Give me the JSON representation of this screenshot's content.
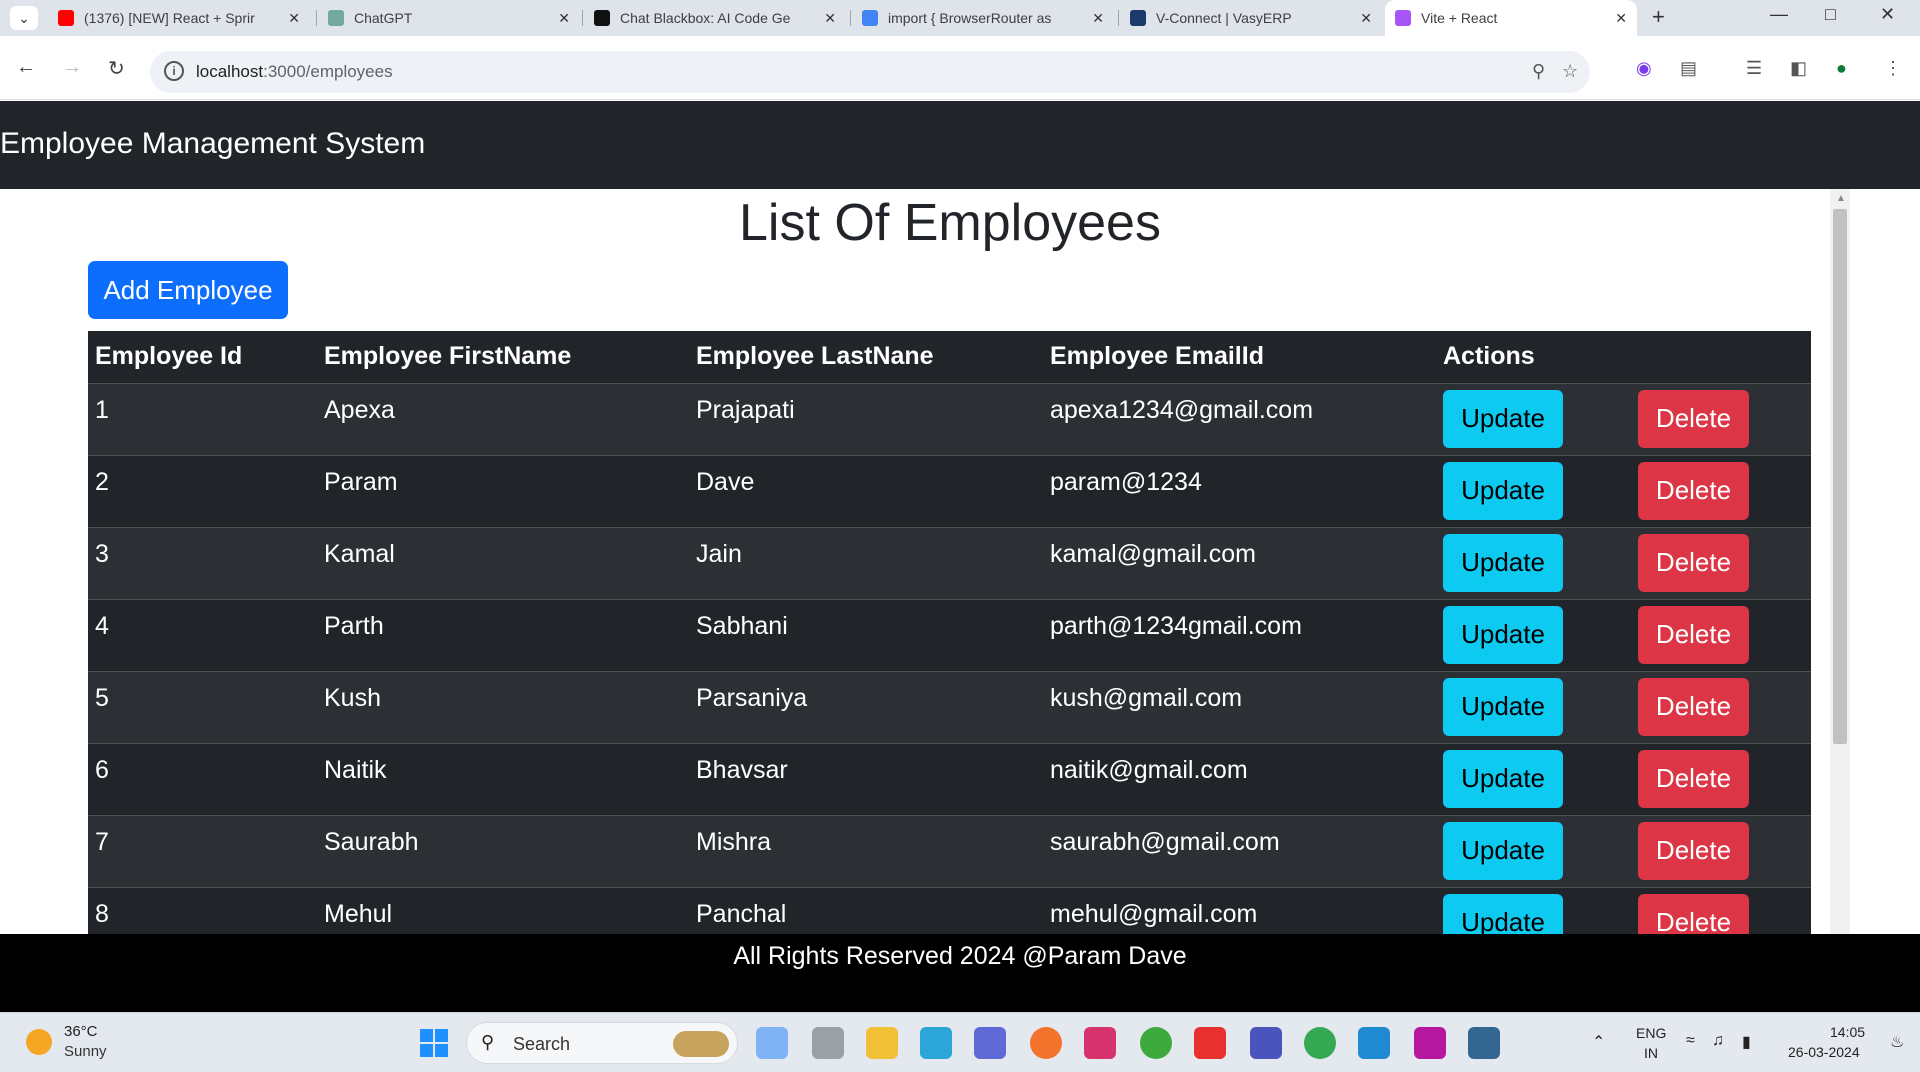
{
  "browser": {
    "tabs": [
      {
        "title": "(1376) [NEW] React + Sprir",
        "color": "#ff0000"
      },
      {
        "title": "ChatGPT",
        "color": "#74aa9c"
      },
      {
        "title": "Chat Blackbox: AI Code Ge",
        "color": "#111111"
      },
      {
        "title": "import { BrowserRouter as",
        "color": "#4285f4"
      },
      {
        "title": "V-Connect | VasyERP",
        "color": "#1b3a6b"
      },
      {
        "title": "Vite + React",
        "color": "#a855f7"
      }
    ],
    "url_host": "localhost",
    "url_path": ":3000/employees"
  },
  "app": {
    "brand": "Employee Management System",
    "page_title": "List Of Employees",
    "add_button": "Add Employee",
    "columns": [
      "Employee Id",
      "Employee FirstName",
      "Employee LastNane",
      "Employee EmailId",
      "Actions"
    ],
    "update_label": "Update",
    "delete_label": "Delete",
    "employees": [
      {
        "id": "1",
        "first": "Apexa",
        "last": "Prajapati",
        "email": "apexa1234@gmail.com"
      },
      {
        "id": "2",
        "first": "Param",
        "last": "Dave",
        "email": "param@1234"
      },
      {
        "id": "3",
        "first": "Kamal",
        "last": "Jain",
        "email": "kamal@gmail.com"
      },
      {
        "id": "4",
        "first": "Parth",
        "last": "Sabhani",
        "email": "parth@1234gmail.com"
      },
      {
        "id": "5",
        "first": "Kush",
        "last": "Parsaniya",
        "email": "kush@gmail.com"
      },
      {
        "id": "6",
        "first": "Naitik",
        "last": "Bhavsar",
        "email": "naitik@gmail.com"
      },
      {
        "id": "7",
        "first": "Saurabh",
        "last": "Mishra",
        "email": "saurabh@gmail.com"
      },
      {
        "id": "8",
        "first": "Mehul",
        "last": "Panchal",
        "email": "mehul@gmail.com"
      }
    ],
    "footer": "All Rights Reserved 2024 @Param Dave"
  },
  "taskbar": {
    "weather_temp": "36°C",
    "weather_cond": "Sunny",
    "search_label": "Search",
    "lang_line1": "ENG",
    "lang_line2": "IN",
    "time": "14:05",
    "date": "26-03-2024"
  }
}
